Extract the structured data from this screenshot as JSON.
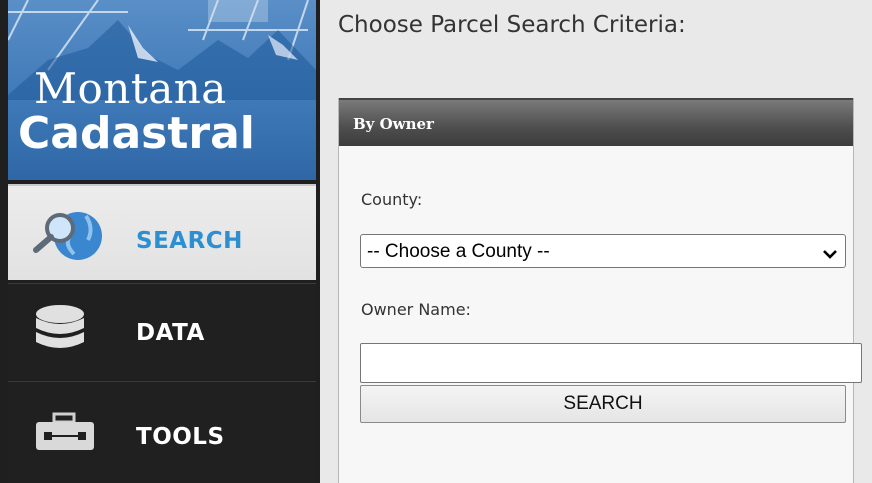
{
  "logo": {
    "line1": "Montana",
    "line2": "Cadastral"
  },
  "nav": {
    "items": [
      {
        "label": "SEARCH",
        "icon": "globe-magnifier-icon",
        "active": true
      },
      {
        "label": "DATA",
        "icon": "database-icon",
        "active": false
      },
      {
        "label": "TOOLS",
        "icon": "toolbox-icon",
        "active": false
      }
    ]
  },
  "main": {
    "title": "Choose Parcel Search Criteria:",
    "panel": {
      "title": "By Owner",
      "county_label": "County:",
      "county_value": "-- Choose a County --",
      "owner_label": "Owner Name:",
      "owner_value": "",
      "search_button": "SEARCH"
    }
  },
  "colors": {
    "accent": "#2b8fd1",
    "sidebar_bg": "#202020",
    "logo_blue": "#3f79b8"
  }
}
